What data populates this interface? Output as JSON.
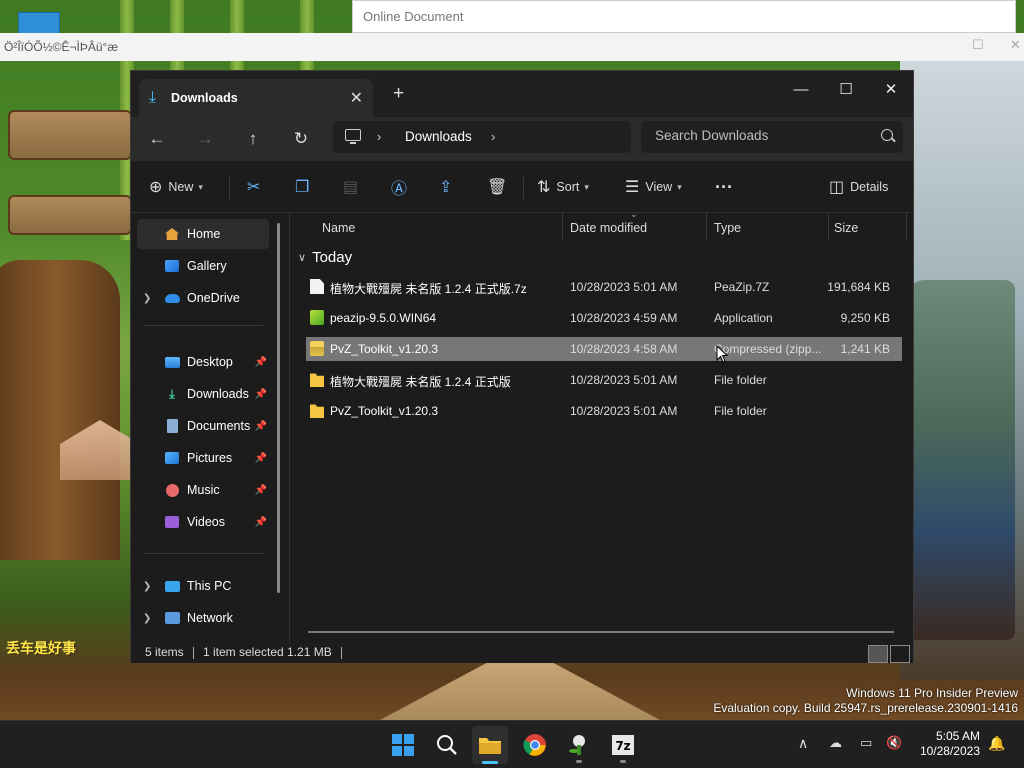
{
  "background": {
    "doc_window_title": "Online Document",
    "garbled_window_title": "Ö²ÎïÓÕ½©Ê¬ÌÞÂü°æ",
    "game_text_1": "丢车是好事"
  },
  "explorer": {
    "tab_title": "Downloads",
    "address": {
      "crumb": "Downloads"
    },
    "search": {
      "placeholder": "Search Downloads"
    },
    "toolbar": {
      "new_label": "New",
      "sort_label": "Sort",
      "view_label": "View",
      "details_label": "Details"
    },
    "sidebar": {
      "items": [
        {
          "label": "Home"
        },
        {
          "label": "Gallery"
        },
        {
          "label": "OneDrive"
        },
        {
          "label": "Desktop"
        },
        {
          "label": "Downloads"
        },
        {
          "label": "Documents"
        },
        {
          "label": "Pictures"
        },
        {
          "label": "Music"
        },
        {
          "label": "Videos"
        },
        {
          "label": "This PC"
        },
        {
          "label": "Network"
        }
      ]
    },
    "columns": {
      "name": "Name",
      "date": "Date modified",
      "type": "Type",
      "size": "Size"
    },
    "group": "Today",
    "files": [
      {
        "name": "植物大戰殭屍 未名版 1.2.4 正式版.7z",
        "date": "10/28/2023 5:01 AM",
        "type": "PeaZip.7Z",
        "size": "191,684 KB"
      },
      {
        "name": "peazip-9.5.0.WIN64",
        "date": "10/28/2023 4:59 AM",
        "type": "Application",
        "size": "9,250 KB"
      },
      {
        "name": "PvZ_Toolkit_v1.20.3",
        "date": "10/28/2023 4:58 AM",
        "type": "Compressed (zipp...",
        "size": "1,241 KB"
      },
      {
        "name": "植物大戰殭屍 未名版 1.2.4 正式版",
        "date": "10/28/2023 5:01 AM",
        "type": "File folder",
        "size": ""
      },
      {
        "name": "PvZ_Toolkit_v1.20.3",
        "date": "10/28/2023 5:01 AM",
        "type": "File folder",
        "size": ""
      }
    ],
    "status": {
      "count": "5 items",
      "selected": "1 item selected  1.21 MB"
    }
  },
  "watermark": {
    "line1": "Windows 11 Pro Insider Preview",
    "line2": "Evaluation copy. Build 25947.rs_prerelease.230901-1416"
  },
  "taskbar": {
    "time": "5:05 AM",
    "date": "10/28/2023"
  }
}
